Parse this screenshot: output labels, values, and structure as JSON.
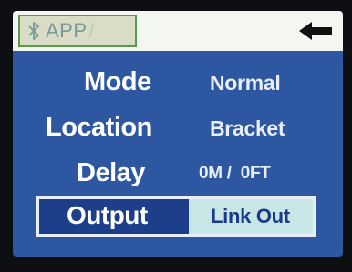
{
  "header": {
    "app_label": "APP",
    "app_label_suffix": "/",
    "bluetooth_icon": "bluetooth-icon",
    "back_icon": "arrow-left-icon"
  },
  "settings": {
    "mode": {
      "label": "Mode",
      "value": "Normal"
    },
    "location": {
      "label": "Location",
      "value": "Bracket"
    },
    "delay": {
      "label": "Delay",
      "value": "0M /  0FT"
    },
    "output": {
      "label": "Output",
      "value": "Link Out"
    }
  },
  "colors": {
    "screen_bg": "#2e57a1",
    "selected_value_bg": "#c8e6e6",
    "selected_value_text": "#1a3a8a",
    "label_text": "#ffffff"
  }
}
